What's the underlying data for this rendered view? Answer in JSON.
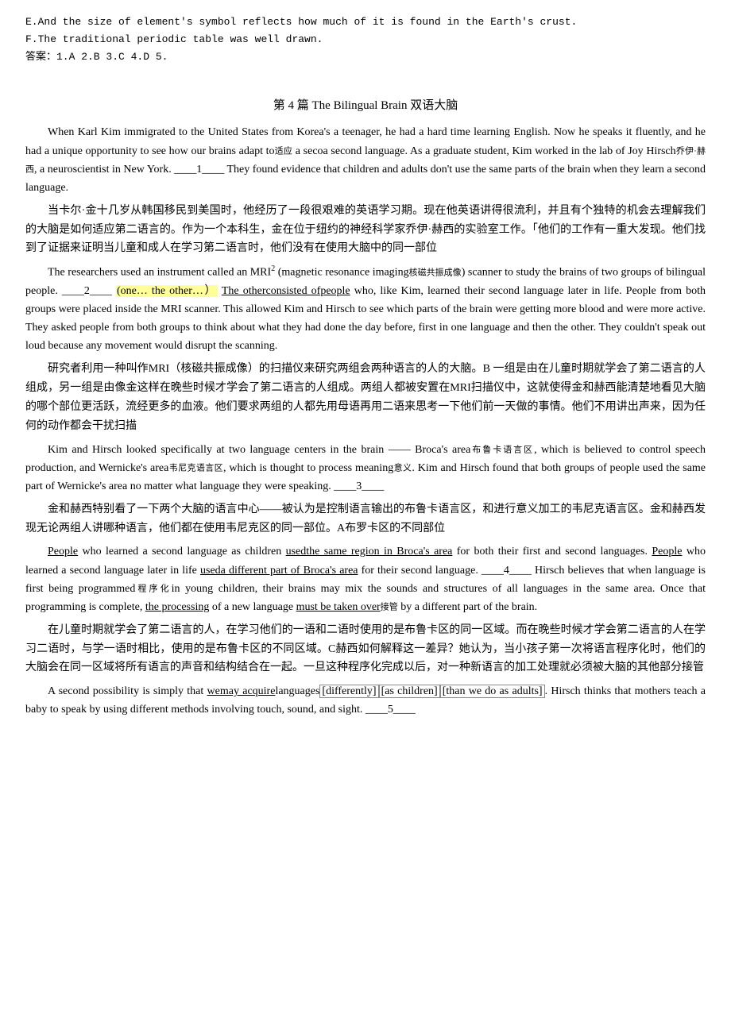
{
  "lines": [
    "E.And the size of element's symbol reflects how much of it is found in the Earth's crust.",
    "F.The traditional periodic table was well drawn.",
    "答案：1.A 2.B 3.C 4.D 5."
  ],
  "section_title": "第 4 篇 The Bilingual Brain 双语大脑",
  "paragraphs": {
    "p1_en": "When Karl Kim immigrated to the United States from Korea's a teenager, he had a hard time learning English. Now he speaks it fluently, and he had a unique opportunity to see how our brains adapt to",
    "p1_en_sup": "适应",
    "p1_en_cont": "a second language. As a graduate student, Kim worked in the lab of Joy Hirsch",
    "p1_cn_sup": "乔伊·赫西",
    "p1_en_cont2": ", a neuroscientist in New York. ____1____ They found evidence that children and adults don't use the same parts of the brain when they learn a second language.",
    "p1_cn": "当卡尔·金十几岁从韩国移民到美国时，他经历了一段很艰难的英语学习期。现在他英语讲得很流利，并且有个独特的机会去理解我们的大脑是如何适应第二语言的。作为一个本科生，金在位于纽约的神经科学家乔伊·赫西的实验室工作。「他们的工作有一重大发现。他们找到了证据来证明当儿童和成人在学习第二语言时，他们没有在使用大脑中的同一部位",
    "p2_en": "The researchers used an instrument called an MRI",
    "p2_en_sup": "2",
    "p2_en_cont": "(magnetic resonance imaging",
    "p2_cn_sup": "核磁共振成像",
    "p2_en_cont2": ") scanner to study the brains of two groups of bilingual people. ____2____ ",
    "p2_highlight": "(one… the other…）",
    "p2_underline": "The otherconsisted ofpeople",
    "p2_en_cont3": " who, like Kim, learned their second language later in life. People from both groups were placed inside the MRI scanner. This allowed Kim and Hirsch to see which parts of the brain were getting more blood and were more active. They asked people from both groups to think about what they had done the day before, first in one language and then the other. They couldn't speak out loud because any movement would disrupt the scanning.",
    "p2_cn": "研究者利用一种叫作MRI（核磁共振成像）的扫描仪来研究两组会两种语言的人的大脑。B 一组是由在儿童时期就学会了第二语言的人组成，另一组是由像金这样在晚些时候才学会了第二语言的人组成。两组人都被安置在MRI扫描仪中，这就使得金和赫西能清楚地看见大脑的哪个部位更活跃，流经更多的血液。他们要求两组的人都先用母语再用二语来思考一下他们前一天做的事情。他们不用讲出声来，因为任何的动作都会干扰扫描",
    "p3_en": "Kim and Hirsch looked specifically at two language centers in the brain —— Broca's area",
    "p3_cn_sup1": "布鲁卡语言区",
    "p3_en_cont": ", which is believed to control speech production, and Wernicke's area",
    "p3_cn_sup2": "韦尼克语言区",
    "p3_en_cont2": ", which is thought to process meaning",
    "p3_cn_sup3": "意义",
    "p3_en_cont3": ". Kim and Hirsch found that both groups of people used the same part of Wernicke's area no matter what language they were speaking. ____3____",
    "p3_cn": "金和赫西特别看了一下两个大脑的语言中心——被认为是控制语言输出的布鲁卡语言区，和进行意义加工的韦尼克语言区。金和赫西发现无论两组人讲哪种语言，他们都在使用韦尼克区的同一部位。A布罗卡区的不同部位",
    "p4_en_people1": "People",
    "p4_en_cont1": " who learned a second language as children ",
    "p4_en_underline1": "usedthe same region in Broca's area",
    "p4_en_cont2": " for both their first and second languages. ",
    "p4_en_people2": "People",
    "p4_en_cont3": " who learned a second language later in life ",
    "p4_en_underline2": "useda different part of Broca's area",
    "p4_en_cont4": " for their second language. ____4____ Hirsch believes that when language is first being programmed",
    "p4_cn_sup1": "程序化",
    "p4_en_cont5": "in young children, their brains may mix the sounds and structures of all languages in the same area. Once that programming is complete, ",
    "p4_en_underline3": "the processing",
    "p4_en_cont6": " of a new language ",
    "p4_en_underline4": "must be taken over",
    "p4_cn_sup2": "接管",
    "p4_en_cont7": " by a different part of the brain.",
    "p4_cn": "在儿童时期就学会了第二语言的人，在学习他们的一语和二语时使用的是布鲁卡区的同一区域。而在晚些时候才学会第二语言的人在学习二语时，与学一语时相比，使用的是布鲁卡区的不同区域。C赫西如何解释这一差异？她认为，当小孩子第一次将语言程序化时，他们的大脑会在同一区域将所有语言的声音和结构结合在一起。一旦这种程序化完成以后，对一种新语言的加工处理就必须被大脑的其他部分接管",
    "p5_en_start": "A second possibility is simply that ",
    "p5_en_underline1": "wemay acquire",
    "p5_en_cont1": "languages",
    "p5_en_bracket1": "[differently]",
    "p5_en_bracket2": "[as children]",
    "p5_en_bracket3": "[than we do as adults]",
    "p5_en_cont2": ". Hirsch thinks that mothers teach a baby to speak by using different methods involving touch, sound, and sight. ____5____"
  }
}
